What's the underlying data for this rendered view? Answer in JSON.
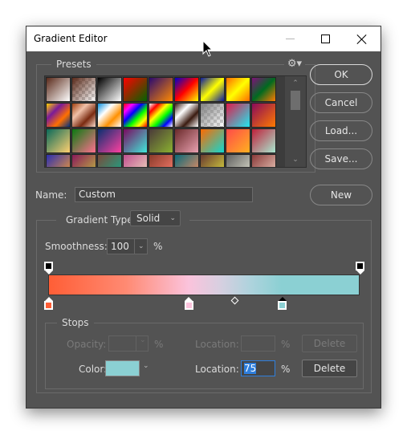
{
  "window": {
    "title": "Gradient Editor",
    "controls": {
      "minimize": "minimize-icon",
      "maximize": "maximize-icon",
      "close": "close-icon"
    }
  },
  "presets": {
    "label": "Presets",
    "settings_icon": "⚙▾",
    "swatches": [
      [
        "#5a2a1a",
        "#ffffff"
      ],
      [
        "#5a2a1a",
        "transparent"
      ],
      [
        "#000000",
        "#ffffff"
      ],
      [
        "#ff0000",
        "#006400"
      ],
      [
        "#2a0a70",
        "#ff8a00"
      ],
      [
        "#0000cc",
        "#ff0000",
        "#ffff00"
      ],
      [
        "#0a1aa0",
        "#ffff00",
        "#0a1aa0"
      ],
      [
        "#ff6a00",
        "#ffff00",
        "#ff6a00"
      ],
      [
        "#80107a",
        "#006a20",
        "#ff7a00"
      ],
      [
        "#ffd000",
        "#7a1a9a",
        "#ff7000",
        "#003080"
      ],
      [
        "#a04010",
        "#f0c0a8",
        "#7a2a10",
        "#f8d8c8"
      ],
      [
        "#0a90e0",
        "#ffffff",
        "#ff9000",
        "#ffffff"
      ],
      [
        "#ff0000",
        "#ff00ff",
        "#0000ff",
        "#00ff00",
        "#ffff00",
        "#ff0000"
      ],
      [
        "#ffffff",
        "#ff0000",
        "#ffff00",
        "#00ff00",
        "#0000ff",
        "#ffffff"
      ],
      [
        "#3a1a10",
        "#ffffff",
        "#3a1a10",
        "#ffffff"
      ],
      [
        "#808080",
        "transparent"
      ],
      [
        "#e01a4a",
        "#20e8f0"
      ],
      [
        "#8a0a5a",
        "#ff7a00"
      ],
      [
        "#0a6a5a",
        "#ffd070"
      ],
      [
        "#0a7a10",
        "#ff7090"
      ],
      [
        "#0a3070",
        "#ff40a0"
      ],
      [
        "#7a0a60",
        "#40e8d8"
      ],
      [
        "#4a3a3a",
        "#8ab030"
      ],
      [
        "#6a2a2a",
        "#e8a0b0"
      ],
      [
        "#ff6a00",
        "#10d8d0"
      ],
      [
        "#ff4a4a",
        "#ffb020"
      ],
      [
        "#c0203a",
        "#a8e8d0"
      ],
      [
        "#2a30b0",
        "#ffa030"
      ],
      [
        "#8a1a5a",
        "#c0c040"
      ],
      [
        "#7a4a3a",
        "#10b090"
      ],
      [
        "#c05090",
        "#f0e0c0"
      ],
      [
        "#8a3a2a",
        "#ff8070"
      ],
      [
        "#0a6a7a",
        "#ff9060"
      ],
      [
        "#6a3a30",
        "#e0e040"
      ],
      [
        "#606060",
        "#e0e0d0"
      ],
      [
        "#8a3a3a",
        "#f0d0c0"
      ]
    ],
    "scroll_up_icon": "^",
    "scroll_down_icon": "v"
  },
  "buttons": {
    "ok": "OK",
    "cancel": "Cancel",
    "load": "Load...",
    "save": "Save...",
    "new": "New"
  },
  "name_field": {
    "label": "Name:",
    "value": "Custom"
  },
  "gradient": {
    "type_label": "Gradient Type:",
    "type_value": "Solid",
    "smoothness_label": "Smoothness:",
    "smoothness_value": "100",
    "smoothness_unit": "%",
    "opacity_stops": [
      {
        "location": 0,
        "color": "#000000"
      },
      {
        "location": 100,
        "color": "#000000"
      }
    ],
    "color_stops": [
      {
        "location": 0,
        "color": "#ff5e36",
        "selected": false
      },
      {
        "location": 45,
        "color": "#fbc3dc",
        "selected": false
      },
      {
        "location": 75,
        "color": "#8bd0d3",
        "selected": true
      }
    ],
    "midpoint_location": 60
  },
  "stops": {
    "label": "Stops",
    "opacity_label": "Opacity:",
    "opacity_value": "",
    "opacity_unit": "%",
    "opacity_location_label": "Location:",
    "opacity_location_value": "",
    "opacity_location_unit": "%",
    "opacity_delete": "Delete",
    "color_label": "Color:",
    "color_value": "#8bd0d3",
    "color_location_label": "Location:",
    "color_location_value": "75",
    "color_location_unit": "%",
    "color_delete": "Delete"
  }
}
